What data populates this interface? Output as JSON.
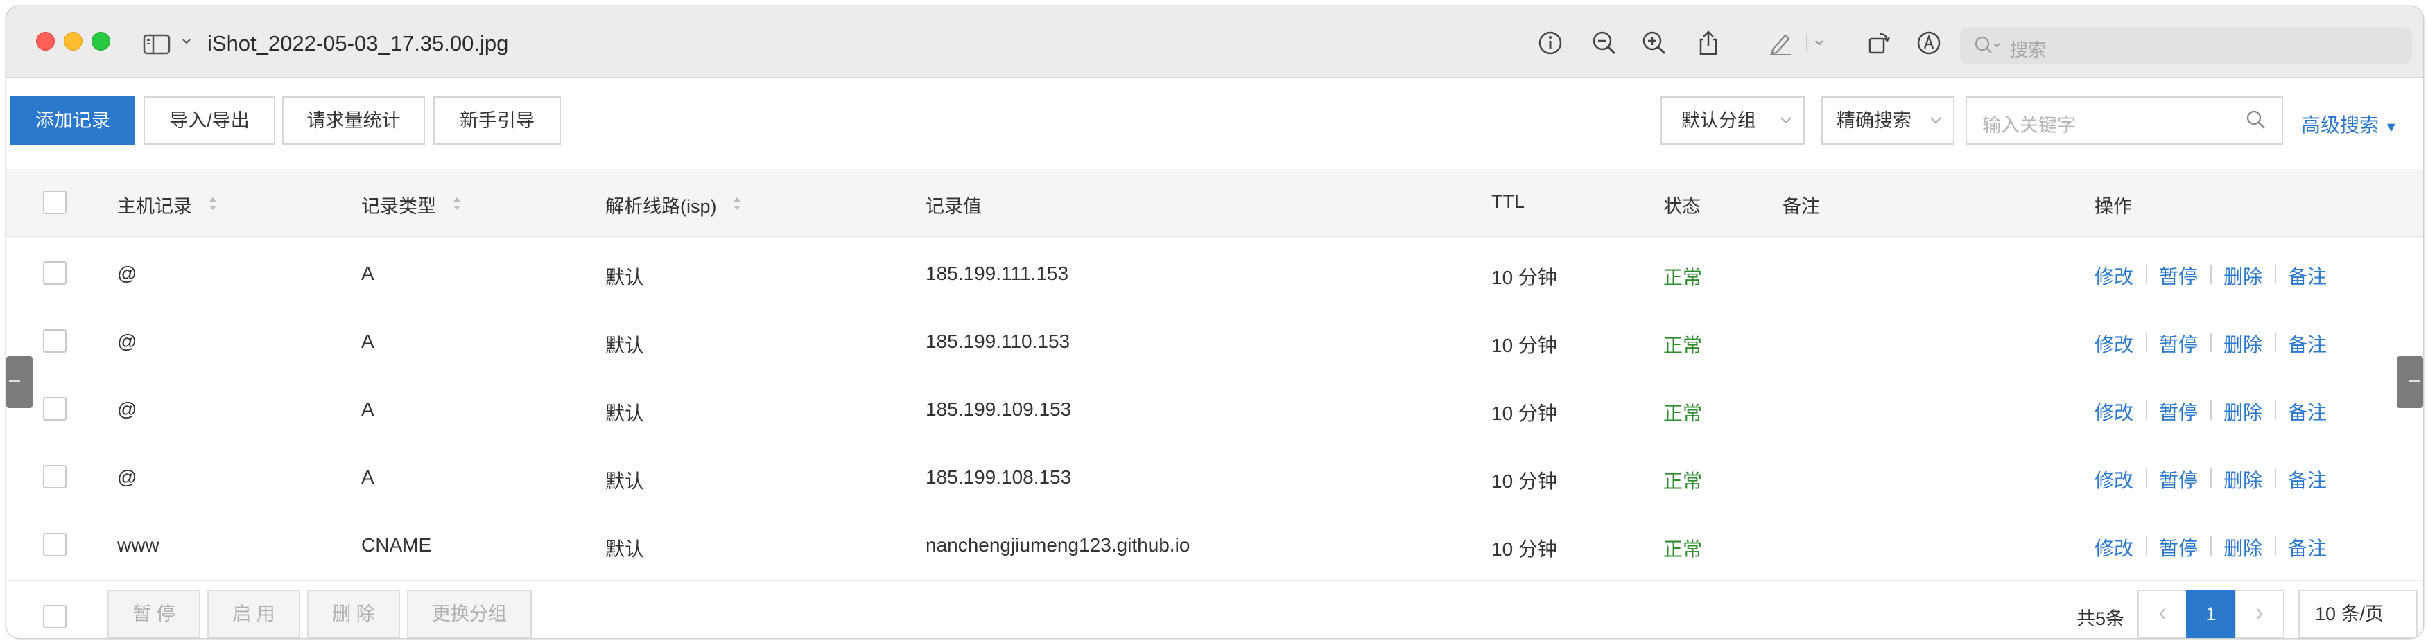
{
  "window": {
    "title": "iShot_2022-05-03_17.35.00.jpg",
    "search_placeholder": "搜索"
  },
  "toolbar": {
    "add_record": "添加记录",
    "import_export": "导入/导出",
    "request_stats": "请求量统计",
    "beginner_guide": "新手引导",
    "group_select": "默认分组",
    "match_select": "精确搜索",
    "keyword_placeholder": "输入关键字",
    "advanced_search": "高级搜索"
  },
  "table": {
    "headers": {
      "host": "主机记录",
      "type": "记录类型",
      "line": "解析线路(isp)",
      "value": "记录值",
      "ttl": "TTL",
      "status": "状态",
      "remark": "备注",
      "actions": "操作"
    },
    "rows": [
      {
        "host": "@",
        "type": "A",
        "line": "默认",
        "value": "185.199.111.153",
        "ttl": "10 分钟",
        "status": "正常",
        "remark": "",
        "checked": false
      },
      {
        "host": "@",
        "type": "A",
        "line": "默认",
        "value": "185.199.110.153",
        "ttl": "10 分钟",
        "status": "正常",
        "remark": "",
        "checked": false
      },
      {
        "host": "@",
        "type": "A",
        "line": "默认",
        "value": "185.199.109.153",
        "ttl": "10 分钟",
        "status": "正常",
        "remark": "",
        "checked": false
      },
      {
        "host": "@",
        "type": "A",
        "line": "默认",
        "value": "185.199.108.153",
        "ttl": "10 分钟",
        "status": "正常",
        "remark": "",
        "checked": false
      },
      {
        "host": "www",
        "type": "CNAME",
        "line": "默认",
        "value": "nanchengjiumeng123.github.io",
        "ttl": "10 分钟",
        "status": "正常",
        "remark": "",
        "checked": false
      }
    ],
    "row_actions": {
      "edit": "修改",
      "pause": "暂停",
      "delete": "删除",
      "remark": "备注"
    }
  },
  "footer": {
    "pause": "暂 停",
    "enable": "启 用",
    "delete": "删 除",
    "change_group": "更换分组",
    "total": "共5条",
    "current_page": "1",
    "page_size": "10 条/页"
  },
  "colors": {
    "accent": "#2b79cd",
    "status_ok": "#2e8b2e",
    "titlebar": "#ececec",
    "header_bg": "#f5f5f5"
  },
  "icons": [
    "info-icon",
    "zoom-out-icon",
    "zoom-in-icon",
    "share-icon",
    "markup-pen-icon",
    "chevron-down-icon",
    "rotate-icon",
    "annotate-icon",
    "search-icon",
    "sidebar-toggle-icon"
  ]
}
